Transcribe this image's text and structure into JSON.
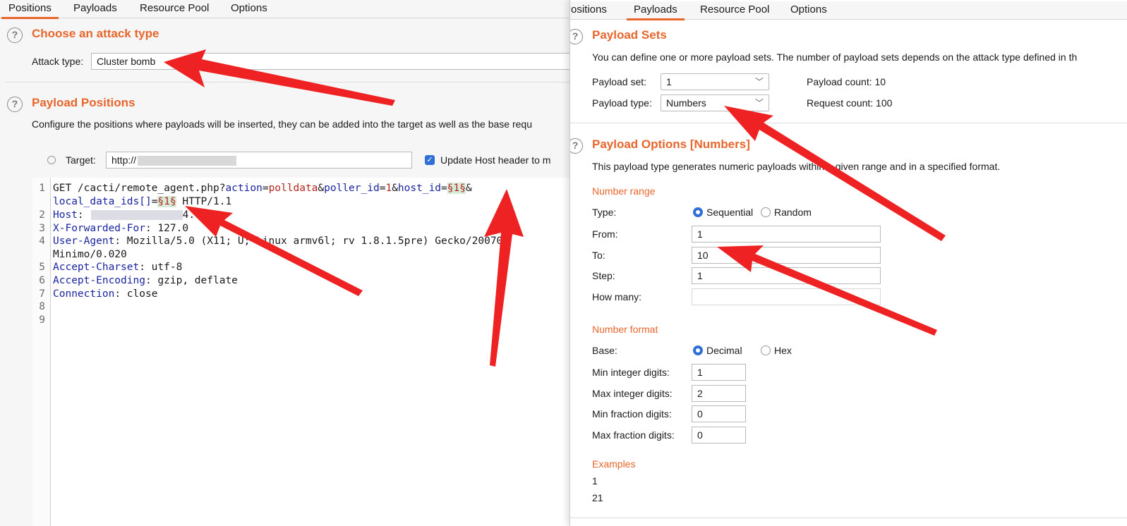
{
  "left": {
    "tabs": [
      "Positions",
      "Payloads",
      "Resource Pool",
      "Options"
    ],
    "attack": {
      "title": "Choose an attack type",
      "label": "Attack type:",
      "value": "Cluster bomb"
    },
    "positions": {
      "title": "Payload Positions",
      "description": "Configure the positions where payloads will be inserted, they can be added into the target as well as the base requ",
      "target_label": "Target:",
      "target_value": "http://",
      "update_host_label": "Update Host header to m"
    },
    "editor": {
      "line_numbers": [
        "1",
        "2",
        "3",
        "4",
        "5",
        "6",
        "7",
        "8",
        "9"
      ],
      "l1_method": "GET /cacti/remote_agent.php?",
      "l1_k1": "action",
      "l1_v1": "polldata",
      "l1_k2": "poller_id",
      "l1_v2": "1",
      "l1_k3": "host_id",
      "l1_m3": "§1§",
      "l1b_k": "local_data_ids[]",
      "l1b_m": "§1§",
      "l1b_tail": " HTTP/1.1",
      "l2_k": "Host",
      "l2_tail": "4.",
      "l3_k": "X-Forwarded-For",
      "l3_v": ": 127.0",
      "l4_k": "User-Agent",
      "l4_v": ": Mozilla/5.0 (X11; U; Linux armv6l; rv 1.8.1.5pre) Gecko/20070",
      "l4b": "Minimo/0.020",
      "l5_k": "Accept-Charset",
      "l5_v": ": utf-8",
      "l6_k": "Accept-Encoding",
      "l6_v": ": gzip, deflate",
      "l7_k": "Connection",
      "l7_v": ": close"
    }
  },
  "right": {
    "tabs": [
      "Positions",
      "Payloads",
      "Resource Pool",
      "Options"
    ],
    "sets": {
      "title": "Payload Sets",
      "description": "You can define one or more payload sets. The number of payload sets depends on the attack type defined in th",
      "set_label": "Payload set:",
      "set_value": "1",
      "count_label": "Payload count: 10",
      "type_label": "Payload type:",
      "type_value": "Numbers",
      "request_label": "Request count: 100"
    },
    "options": {
      "title": "Payload Options [Numbers]",
      "description": "This payload type generates numeric payloads within a given range and in a specified format.",
      "range_title": "Number range",
      "type_label": "Type:",
      "sequential": "Sequential",
      "random": "Random",
      "from_label": "From:",
      "from_value": "1",
      "to_label": "To:",
      "to_value": "10",
      "step_label": "Step:",
      "step_value": "1",
      "howmany_label": "How many:",
      "howmany_value": "",
      "format_title": "Number format",
      "base_label": "Base:",
      "decimal": "Decimal",
      "hex": "Hex",
      "min_int_label": "Min integer digits:",
      "min_int_value": "1",
      "max_int_label": "Max integer digits:",
      "max_int_value": "2",
      "min_frac_label": "Min fraction digits:",
      "min_frac_value": "0",
      "max_frac_label": "Max fraction digits:",
      "max_frac_value": "0",
      "examples_title": "Examples",
      "example_1": "1",
      "example_2": "21"
    }
  },
  "colors": {
    "accent": "#e8662c",
    "arrow": "#ee2222",
    "key": "#1a24a0",
    "value": "#b3261e"
  }
}
